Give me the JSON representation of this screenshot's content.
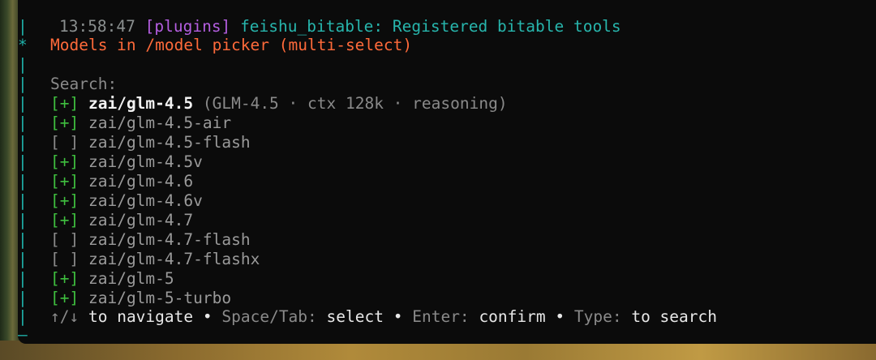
{
  "log": {
    "time": "13:58:47",
    "tag": "[plugins]",
    "message": "feishu_bitable: Registered bitable tools"
  },
  "gutter": {
    "pipe": "|",
    "star": "*",
    "end": "—"
  },
  "picker": {
    "title": "Models in /model picker (multi-select)",
    "search_label": "Search:",
    "items": [
      {
        "mark": "[+]",
        "name": "zai/glm-4.5",
        "detail": "(GLM-4.5 · ctx 128k · reasoning)"
      },
      {
        "mark": "[+]",
        "name": "zai/glm-4.5-air",
        "detail": ""
      },
      {
        "mark": "[ ]",
        "name": "zai/glm-4.5-flash",
        "detail": ""
      },
      {
        "mark": "[+]",
        "name": "zai/glm-4.5v",
        "detail": ""
      },
      {
        "mark": "[+]",
        "name": "zai/glm-4.6",
        "detail": ""
      },
      {
        "mark": "[+]",
        "name": "zai/glm-4.6v",
        "detail": ""
      },
      {
        "mark": "[+]",
        "name": "zai/glm-4.7",
        "detail": ""
      },
      {
        "mark": "[ ]",
        "name": "zai/glm-4.7-flash",
        "detail": ""
      },
      {
        "mark": "[ ]",
        "name": "zai/glm-4.7-flashx",
        "detail": ""
      },
      {
        "mark": "[+]",
        "name": "zai/glm-5",
        "detail": ""
      },
      {
        "mark": "[+]",
        "name": "zai/glm-5-turbo",
        "detail": ""
      }
    ]
  },
  "help": {
    "arrows": "↑/↓",
    "navigate": "to navigate",
    "bullet": "•",
    "select_key": "Space/Tab:",
    "select": "select",
    "confirm_key": "Enter:",
    "confirm": "confirm",
    "search_key": "Type:",
    "search": "to search"
  }
}
